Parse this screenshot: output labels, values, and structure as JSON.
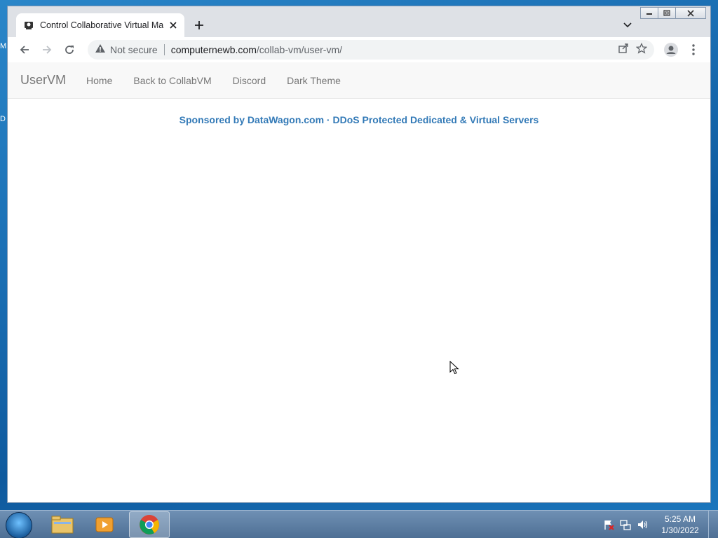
{
  "desktop": {
    "stub_1": "M",
    "stub_2": "D"
  },
  "browser": {
    "tab_title": "Control Collaborative Virtual Machines",
    "security_label": "Not secure",
    "url_host": "computernewb.com",
    "url_path": "/collab-vm/user-vm/"
  },
  "page": {
    "brand": "UserVM",
    "nav": [
      "Home",
      "Back to CollabVM",
      "Discord",
      "Dark Theme"
    ],
    "sponsor_text": "Sponsored by DataWagon.com · DDoS Protected Dedicated & Virtual Servers"
  },
  "taskbar": {
    "time": "5:25 AM",
    "date": "1/30/2022"
  },
  "colors": {
    "link_blue": "#337ab7",
    "nav_text": "#777777",
    "navbar_bg": "#f8f8f8"
  }
}
